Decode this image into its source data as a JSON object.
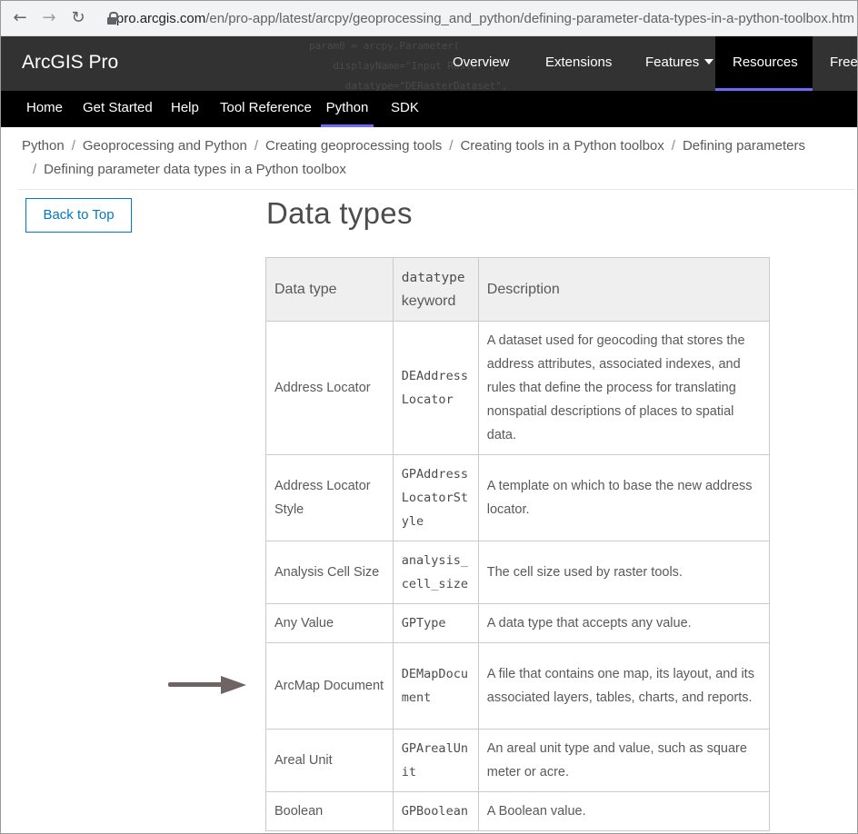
{
  "browser": {
    "url_host": "pro.arcgis.com",
    "url_path": "/en/pro-app/latest/arcpy/geoprocessing_and_python/defining-parameter-data-types-in-a-python-toolbox.htm",
    "back_icon": "arrow-left-icon",
    "forward_icon": "arrow-right-icon",
    "reload_icon": "reload-icon",
    "lock_icon": "lock-icon"
  },
  "header": {
    "brand": "ArcGIS Pro",
    "nav": {
      "overview": "Overview",
      "extensions": "Extensions",
      "features": "Features",
      "resources": "Resources",
      "free": "Free"
    },
    "accent_color": "#6a6aff"
  },
  "subnav": {
    "home": "Home",
    "get_started": "Get Started",
    "help": "Help",
    "tool_reference": "Tool Reference",
    "python": "Python",
    "sdk": "SDK"
  },
  "breadcrumb": {
    "items": [
      "Python",
      "Geoprocessing and Python",
      "Creating geoprocessing tools",
      "Creating tools in a Python toolbox",
      "Defining parameters",
      "Defining parameter data types in a Python toolbox"
    ],
    "separator": "/"
  },
  "sidebar": {
    "back_to_top": "Back to Top"
  },
  "main": {
    "title": "Data types",
    "table": {
      "headers": {
        "data_type": "Data type",
        "keyword_code": "datatype",
        "keyword_word": "keyword",
        "description": "Description"
      },
      "rows": [
        {
          "type": "Address Locator",
          "keyword": "DEAddressLocator",
          "description": "A dataset used for geocoding that stores the address attributes, associated indexes, and rules that define the process for translating nonspatial descriptions of places to spatial data."
        },
        {
          "type": "Address Locator Style",
          "keyword": "GPAddressLocatorStyle",
          "description": "A template on which to base the new address locator."
        },
        {
          "type": "Analysis Cell Size",
          "keyword": "analysis_cell_size",
          "description": "The cell size used by raster tools."
        },
        {
          "type": "Any Value",
          "keyword": "GPType",
          "description": "A data type that accepts any value."
        },
        {
          "type": "ArcMap Document",
          "keyword": "DEMapDocument",
          "description": "A file that contains one map, its layout, and its associated layers, tables, charts, and reports."
        },
        {
          "type": "Areal Unit",
          "keyword": "GPArealUnit",
          "description": "An areal unit type and value, such as square meter or acre."
        },
        {
          "type": "Boolean",
          "keyword": "GPBoolean",
          "description": "A Boolean value."
        }
      ]
    }
  },
  "annotation": {
    "arrow_icon": "arrow-right-icon",
    "arrow_color": "#6e6464"
  }
}
